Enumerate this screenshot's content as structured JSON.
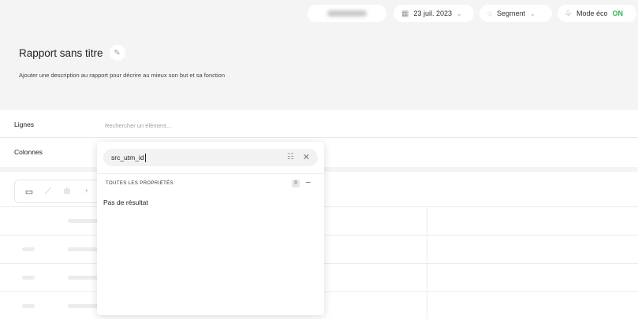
{
  "topbar": {
    "date_label": "23 juil. 2023",
    "segment_label": "Segment",
    "eco_label": "Mode éco",
    "eco_state": "ON",
    "icons": {
      "calendar": "calendar-icon",
      "segment": "segment-icon",
      "eco": "leaf-icon",
      "chevron": "chevron-down-icon"
    }
  },
  "report": {
    "title": "Rapport sans titre",
    "description": "Ajouter une description au rapport pour décrire au mieux son but et sa fonction"
  },
  "dimensions": {
    "rows_label": "Lignes",
    "rows_placeholder": "Rechercher un élément...",
    "columns_label": "Colonnes"
  },
  "viz_toolbar": {
    "icons": [
      "table-icon",
      "line-chart-icon",
      "bar-chart-icon",
      "pie-chart-icon"
    ]
  },
  "dropdown": {
    "search_value": "src_utm_id",
    "section_label": "TOUTES LES PROPRIÉTÉS",
    "section_count": "0",
    "collapse_symbol": "–",
    "empty_text": "Pas de résultat"
  },
  "colors": {
    "accent_on": "#35b05a",
    "header_bg": "#f3f4f3"
  }
}
